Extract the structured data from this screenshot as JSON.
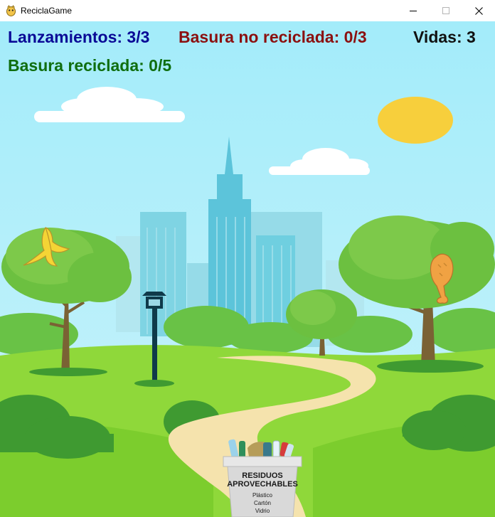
{
  "window": {
    "title": "ReciclaGame",
    "icon": "python-game-icon",
    "controls": [
      "minimize",
      "maximize",
      "close"
    ]
  },
  "hud": {
    "lanzamientos": "Lanzamientos: 3/3",
    "no_reciclada": "Basura no reciclada: 0/3",
    "vidas": "Vidas: 3",
    "reciclada": "Basura reciclada: 0/5"
  },
  "bin": {
    "title_line1": "RESIDUOS",
    "title_line2": "APROVECHABLES",
    "items": [
      "Plástico",
      "Cartón",
      "Vidrio"
    ]
  },
  "falling_items": [
    "banana-peel",
    "chicken-leg"
  ],
  "colors": {
    "sky": "#a6ecf8",
    "grass": "#8fd83a",
    "path": "#f5e3ad",
    "sun": "#f7cf3c",
    "lanzamientos": "#0a0a96",
    "no_reciclada": "#8b1010",
    "reciclada": "#0f6e0f"
  }
}
